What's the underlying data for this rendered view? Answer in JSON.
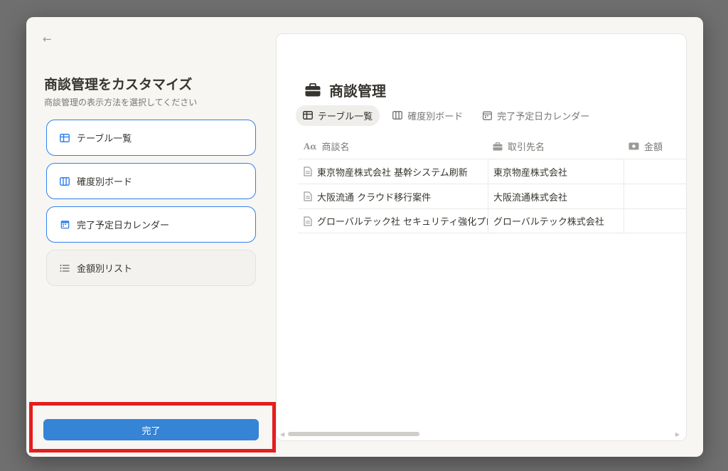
{
  "left_panel": {
    "back_glyph": "←",
    "title": "商談管理をカスタマイズ",
    "subtitle": "商談管理の表示方法を選択してください",
    "options": [
      {
        "label": "テーブル一覧",
        "icon": "table-icon",
        "selected": true
      },
      {
        "label": "確度別ボード",
        "icon": "board-icon",
        "selected": true
      },
      {
        "label": "完了予定日カレンダー",
        "icon": "calendar-icon",
        "selected": true
      },
      {
        "label": "金額別リスト",
        "icon": "list-icon",
        "selected": false
      }
    ],
    "done_label": "完了"
  },
  "preview": {
    "title": "商談管理",
    "title_icon": "briefcase-icon",
    "tabs": [
      {
        "label": "テーブル一覧",
        "icon": "table-icon",
        "active": true
      },
      {
        "label": "確度別ボード",
        "icon": "board-icon",
        "active": false
      },
      {
        "label": "完了予定日カレンダー",
        "icon": "calendar-icon",
        "active": false
      }
    ],
    "columns": [
      {
        "label": "商談名",
        "icon_text": "Aα"
      },
      {
        "label": "取引先名",
        "icon": "briefcase-icon"
      },
      {
        "label": "金額",
        "icon": "money-icon"
      }
    ],
    "rows": [
      {
        "name": "東京物産株式会社 基幹システム刷新",
        "client": "東京物産株式会社",
        "amount": ""
      },
      {
        "name": "大阪流通 クラウド移行案件",
        "client": "大阪流通株式会社",
        "amount": ""
      },
      {
        "name": "グローバルテック社 セキュリティ強化プロジェクト",
        "client": "グローバルテック株式会社",
        "amount": ""
      }
    ]
  },
  "colors": {
    "accent": "#2f80ed",
    "done_button": "#3584d6",
    "highlight": "#e41e1e",
    "backdrop": "#6f6f6f"
  }
}
